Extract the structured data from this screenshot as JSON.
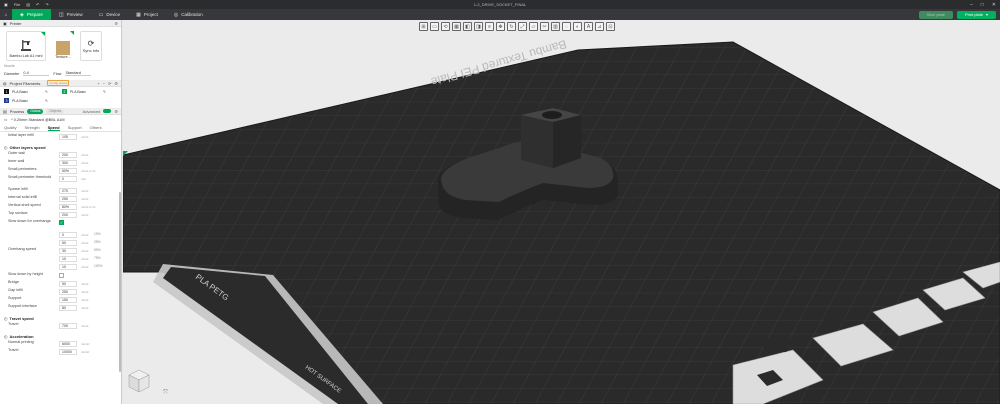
{
  "titlebar": {
    "menu_label": "File",
    "window_title": "1-2_DRIVE_SOCKET_FINAL"
  },
  "tabs": [
    {
      "label": "Prepare",
      "icon": "prepare-icon",
      "active": true
    },
    {
      "label": "Preview",
      "icon": "preview-icon",
      "active": false
    },
    {
      "label": "Device",
      "icon": "device-icon",
      "active": false
    },
    {
      "label": "Project",
      "icon": "project-icon",
      "active": false
    },
    {
      "label": "Calibration",
      "icon": "calibration-icon",
      "active": false
    }
  ],
  "actions": {
    "slice_label": "Slice plate",
    "print_label": "Print plate"
  },
  "printer": {
    "section_title": "Printer",
    "printer_name": "Bambu Lab A1 mini",
    "plate_name": "Texture...",
    "sync_label": "Sync info",
    "nozzle_caption": "Nozzle",
    "diameter_label": "Diameter",
    "diameter_value": "0.4",
    "flow_label": "Flow",
    "flow_value": "Standard"
  },
  "filaments": {
    "section_title": "Project Filaments",
    "badge": "Config issues",
    "items": [
      {
        "num": "1",
        "name": "PLA Basic",
        "color": "#111111"
      },
      {
        "num": "2",
        "name": "PLA Basic",
        "color": "#00a85a"
      },
      {
        "num": "3",
        "name": "PLA Basic",
        "color": "#1f3a8a"
      }
    ]
  },
  "process": {
    "section_title": "Process",
    "global_label": "Global",
    "objects_label": "Objects",
    "advanced_label": "Advanced",
    "preset_name": "* 0.20mm Standard @BBL A1M",
    "tabs": [
      "Quality",
      "Strength",
      "Speed",
      "Support",
      "Others"
    ],
    "active_tab": "Speed",
    "first_row": {
      "label": "Initial layer infill",
      "value": "105",
      "unit": "mm/s"
    },
    "group_other": "Other layers speed",
    "rows": [
      {
        "label": "Outer wall",
        "value": "200",
        "unit": "mm/s"
      },
      {
        "label": "Inner wall",
        "value": "300",
        "unit": "mm/s"
      },
      {
        "label": "Small perimeters",
        "value": "50%",
        "unit": "mm/s or %"
      },
      {
        "label": "Small perimeter threshold",
        "value": "0",
        "unit": "mm"
      },
      {
        "label": "Sparse infill",
        "value": "270",
        "unit": "mm/s"
      },
      {
        "label": "Internal solid infill",
        "value": "250",
        "unit": "mm/s"
      },
      {
        "label": "Vertical shell speed",
        "value": "80%",
        "unit": "mm/s or %"
      },
      {
        "label": "Top surface",
        "value": "200",
        "unit": "mm/s"
      }
    ],
    "slow_overhang_label": "Slow down for overhangs",
    "overhang_label": "Overhang speed",
    "overhang_rows": [
      {
        "value": "0",
        "pct": "10%"
      },
      {
        "value": "50",
        "pct": "25%"
      },
      {
        "value": "30",
        "pct": "50%"
      },
      {
        "value": "10",
        "pct": "75%"
      },
      {
        "value": "10",
        "pct": "100%"
      }
    ],
    "slow_height_label": "Slow down by height",
    "rows2": [
      {
        "label": "Bridge",
        "value": "50",
        "unit": "mm/s"
      },
      {
        "label": "Gap infill",
        "value": "250",
        "unit": "mm/s"
      },
      {
        "label": "Support",
        "value": "150",
        "unit": "mm/s"
      },
      {
        "label": "Support interface",
        "value": "80",
        "unit": "mm/s"
      }
    ],
    "group_travel": "Travel speed",
    "travel_row": {
      "label": "Travel",
      "value": "700",
      "unit": "mm/s"
    },
    "group_accel": "Acceleration",
    "accel_rows": [
      {
        "label": "Normal printing",
        "value": "6000",
        "unit": "mm/s²"
      },
      {
        "label": "Travel",
        "value": "10000",
        "unit": "mm/s²"
      }
    ]
  },
  "viewport": {
    "plate_title": "Bambu Textured PEI Plate",
    "plate_label": "PLA PETG",
    "hot_surface": "HOT SURFACE",
    "bed_color": "#2a2a2a",
    "accent": "#00a85a"
  }
}
